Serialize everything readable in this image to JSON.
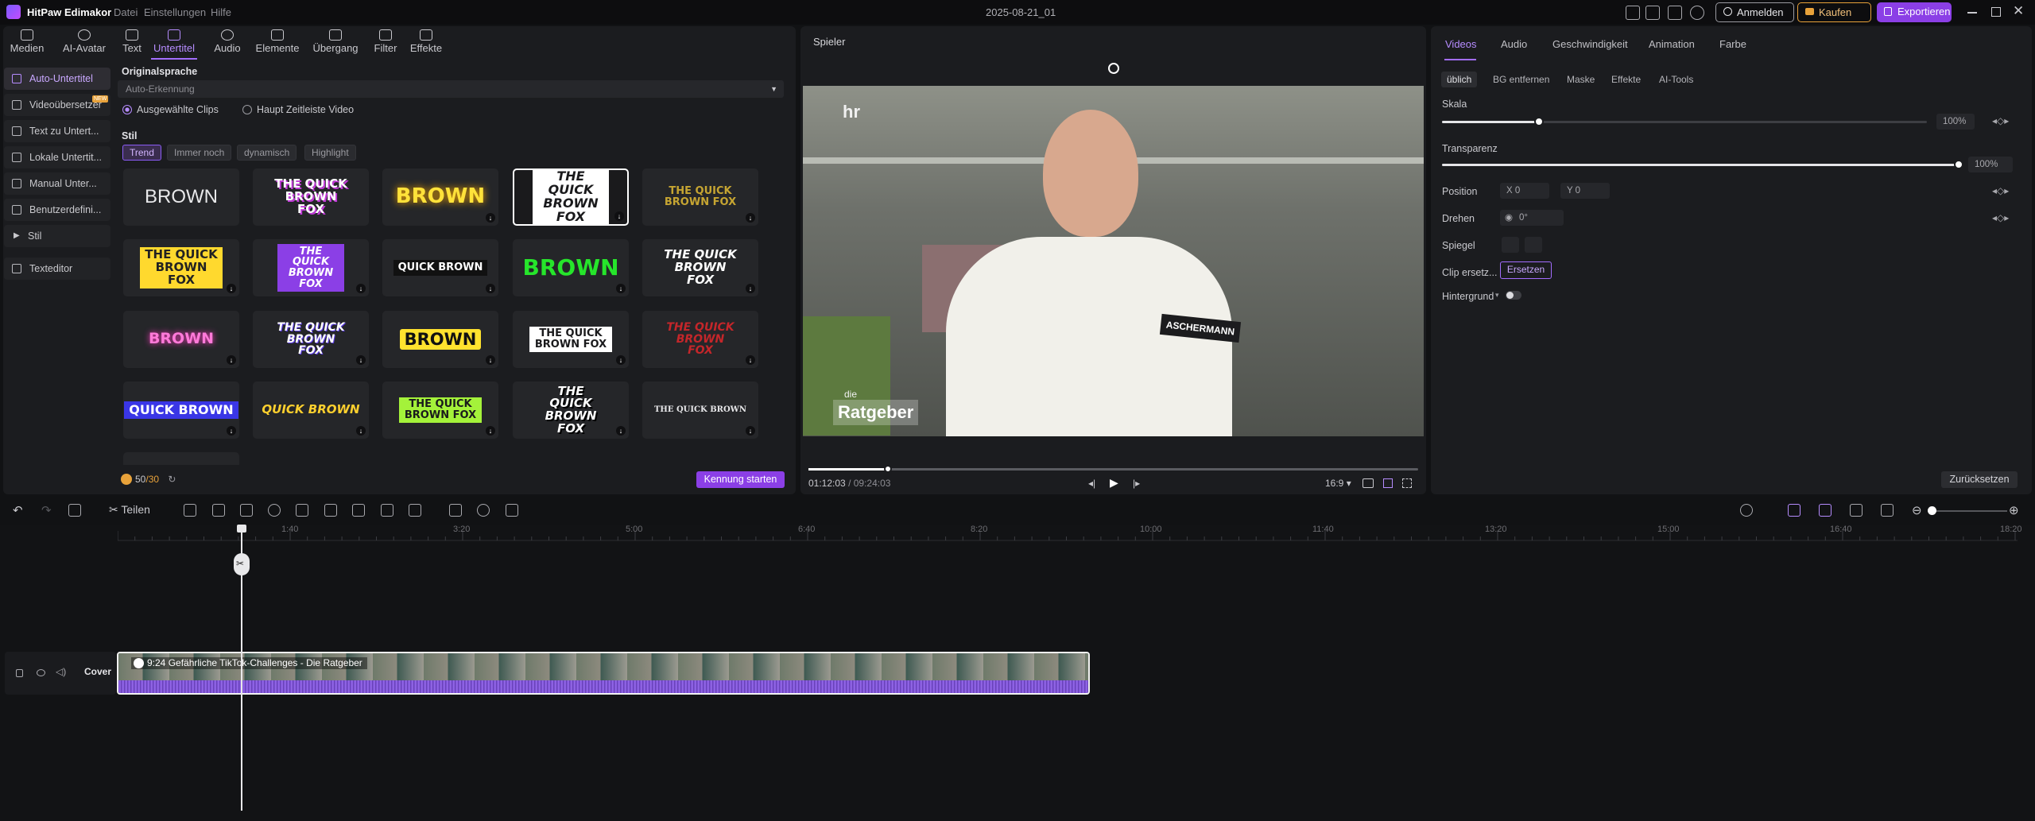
{
  "titlebar": {
    "app_name": "HitPaw Edimakor",
    "menu": [
      "Datei",
      "Einstellungen",
      "Hilfe"
    ],
    "project_name": "2025-08-21_01",
    "login_label": "Anmelden",
    "buy_label": "Kaufen",
    "export_label": "Exportieren",
    "accent": "#8b3fe6"
  },
  "media_tabs": [
    {
      "label": "Medien",
      "icon": "media-icon"
    },
    {
      "label": "AI-Avatar",
      "icon": "avatar-icon"
    },
    {
      "label": "Text",
      "icon": "text-icon"
    },
    {
      "label": "Untertitel",
      "icon": "subtitle-icon",
      "active": true
    },
    {
      "label": "Audio",
      "icon": "music-icon"
    },
    {
      "label": "Elemente",
      "icon": "elements-icon"
    },
    {
      "label": "Übergang",
      "icon": "transition-icon"
    },
    {
      "label": "Filter",
      "icon": "filter-icon"
    },
    {
      "label": "Effekte",
      "icon": "effects-icon"
    }
  ],
  "sidebar": {
    "items": [
      {
        "label": "Auto-Untertitel",
        "active": true
      },
      {
        "label": "Videoübersetzer",
        "badge": "NEW"
      },
      {
        "label": "Text zu Untert..."
      },
      {
        "label": "Lokale Untertit..."
      },
      {
        "label": "Manual Unter..."
      },
      {
        "label": "Benutzerdefini..."
      },
      {
        "label": "Stil"
      },
      {
        "label": "Texteditor"
      }
    ]
  },
  "subtitle_panel": {
    "lang_title": "Originalsprache",
    "lang_value": "Auto-Erkennung",
    "radio_selected": "Ausgewählte Clips",
    "radio_other": "Haupt Zeitleiste Video",
    "style_title": "Stil",
    "style_chips": [
      "Trend",
      "Immer noch",
      "dynamisch",
      "Highlight"
    ],
    "tiles": [
      [
        "BROWN",
        "THE QUICK BROWN FOX",
        "BROWN",
        "THE QUICK BROWN FOX",
        "THE QUICK BROWN FOX"
      ],
      [
        "THE QUICK BROWN FOX",
        "THE QUICK BROWN FOX",
        "QUICK BROWN",
        "BROWN",
        "THE QUICK BROWN FOX"
      ],
      [
        "BROWN",
        "THE QUICK BROWN FOX",
        "BROWN",
        "THE QUICK BROWN FOX",
        "THE QUICK BROWN FOX"
      ],
      [
        "QUICK BROWN",
        "QUICK BROWN",
        "THE QUICK BROWN FOX",
        "THE QUICK BROWN FOX",
        "THE QUICK BROWN"
      ]
    ],
    "credits_used": "50",
    "credits_total": "/30",
    "start_label": "Kennung starten"
  },
  "player": {
    "title": "Spieler",
    "current_time": "01:12:03",
    "total_time": "/ 09:24:03",
    "aspect": "16:9",
    "progress": 0.13,
    "overlay_logo_top": "die",
    "overlay_logo": "Ratgeber",
    "name_tag": "ASCHERMANN",
    "channel_mark": "hr"
  },
  "properties": {
    "tabs": [
      "Videos",
      "Audio",
      "Geschwindigkeit",
      "Animation",
      "Farbe"
    ],
    "subtabs": [
      "üblich",
      "BG entfernen",
      "Maske",
      "Effekte",
      "AI-Tools"
    ],
    "scale_label": "Skala",
    "scale_value": "100%",
    "scale_level": 0.2,
    "opacity_label": "Transparenz",
    "opacity_value": "100%",
    "opacity_level": 1.0,
    "position_label": "Position",
    "pos_x_label": "X",
    "pos_x": "0",
    "pos_y_label": "Y",
    "pos_y": "0",
    "rotate_label": "Drehen",
    "rotate_value": "0°",
    "mirror_label": "Spiegel",
    "replace_label": "Clip ersetz...",
    "replace_button": "Ersetzen",
    "background_label": "Hintergrund",
    "reset_label": "Zurücksetzen"
  },
  "timeline": {
    "split_label": "Teilen",
    "ticks": [
      "1:40",
      "3:20",
      "5:00",
      "6:40",
      "8:20",
      "10:00",
      "11:40",
      "13:20",
      "15:00",
      "16:40",
      "18:20"
    ],
    "cover_label": "Cover",
    "clip_title": "9:24 Gefährliche TikTok-Challenges - Die Ratgeber"
  }
}
